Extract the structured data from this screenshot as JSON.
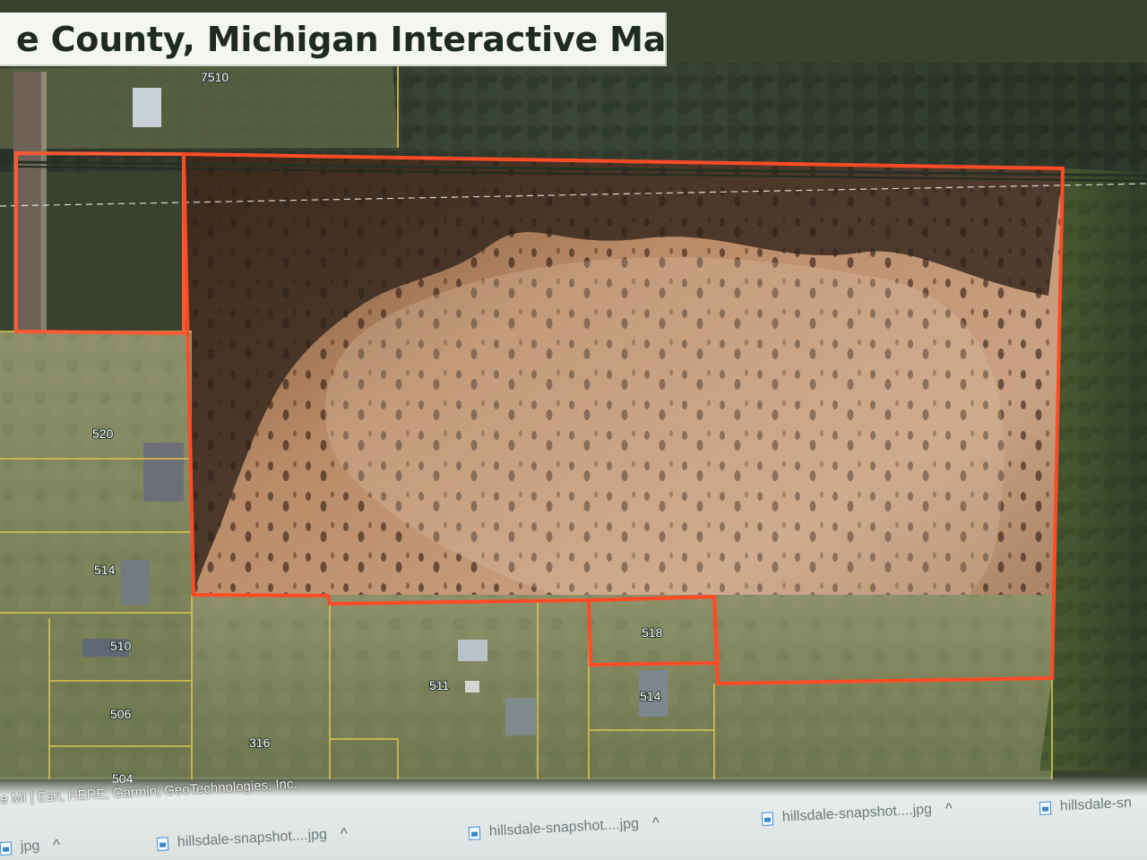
{
  "app": {
    "title": "County, Michigan Interactive Map",
    "title_prefix_partial": "e"
  },
  "map": {
    "attribution": "e MI | Esri, HERE, Garmin, GeoTechnologies, Inc.",
    "parcel_numbers": {
      "top_corner": "7510",
      "left_upper": "520",
      "left_middle": "514",
      "left_lower_1": "510",
      "left_lower_2": "506",
      "left_lower_3": "504",
      "bottom_middle_left": "316",
      "bottom_middle_right": "511",
      "notch_lot": "518",
      "bottom_right": "514"
    },
    "colors": {
      "highlight_outline": "#ff4b26",
      "parcel_lines": "#d9c84f",
      "property_outline": "#ff5a33"
    }
  },
  "taskbar": {
    "downloads": [
      {
        "label": "jpg",
        "icon": "file-icon",
        "chevron": "^"
      },
      {
        "label": "hillsdale-snapshot....jpg",
        "icon": "file-icon",
        "chevron": "^"
      },
      {
        "label": "hillsdale-snapshot....jpg",
        "icon": "file-icon",
        "chevron": "^"
      },
      {
        "label": "hillsdale-snapshot....jpg",
        "icon": "file-icon",
        "chevron": "^"
      },
      {
        "label": "hillsdale-sn",
        "icon": "file-icon",
        "chevron": ""
      }
    ]
  }
}
